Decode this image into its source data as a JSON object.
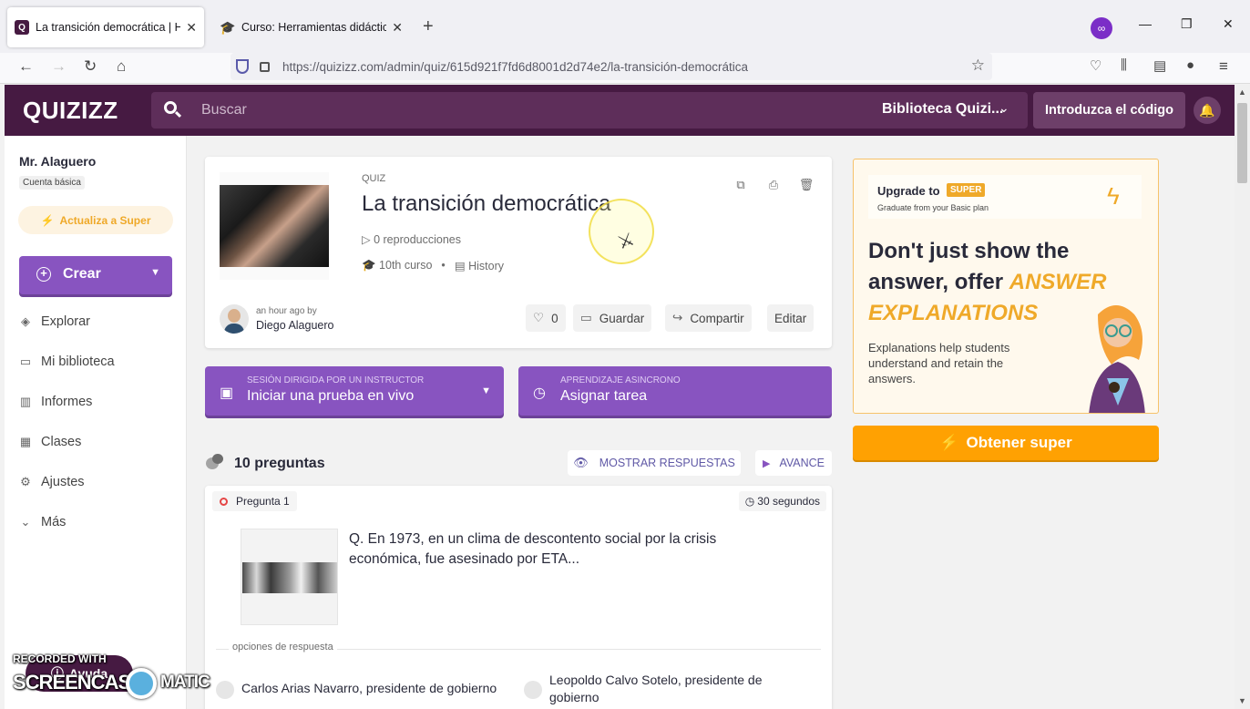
{
  "browser": {
    "tabs": [
      {
        "title": "La transición democrática | Hist",
        "active": true,
        "favicon": "quizizz-icon"
      },
      {
        "title": "Curso: Herramientas didácticas",
        "active": false,
        "favicon": "graduation-cap-icon"
      }
    ],
    "url": "https://quizizz.com/admin/quiz/615d921f7fd6d8001d2d74e2/la-transición-democrática"
  },
  "header": {
    "logo": "QUIZIZZ",
    "search_placeholder": "Buscar",
    "library_select": "Biblioteca Quizi...",
    "enter_code": "Introduzca el código"
  },
  "sidebar": {
    "user_name": "Mr. Alaguero",
    "account_type": "Cuenta básica",
    "upgrade_label": "Actualiza a Super",
    "create_label": "Crear",
    "items": [
      {
        "label": "Explorar",
        "icon": "compass-icon"
      },
      {
        "label": "Mi biblioteca",
        "icon": "folder-icon"
      },
      {
        "label": "Informes",
        "icon": "chart-icon"
      },
      {
        "label": "Clases",
        "icon": "classes-icon"
      },
      {
        "label": "Ajustes",
        "icon": "gear-icon"
      },
      {
        "label": "Más",
        "icon": "chevron-down-icon"
      }
    ]
  },
  "quiz": {
    "type_label": "QUIZ",
    "title": "La transición democrática",
    "plays": "0 reproducciones",
    "grade": "10th curso",
    "subject": "History",
    "updated": "an hour ago by",
    "author": "Diego Alaguero",
    "likes": "0",
    "save_label": "Guardar",
    "share_label": "Compartir",
    "edit_label": "Editar"
  },
  "host": {
    "live_sub": "SESIÓN DIRIGIDA POR UN INSTRUCTOR",
    "live_main": "Iniciar una prueba en vivo",
    "async_sub": "APRENDIZAJE ASINCRONO",
    "async_main": "Asignar tarea"
  },
  "questions": {
    "count_label": "10 preguntas",
    "show_answers": "MOSTRAR RESPUESTAS",
    "advance": "AVANCE",
    "items": [
      {
        "number": "Pregunta 1",
        "time": "30 segundos",
        "text": "Q. En 1973, en un clima de descontento social por la crisis económica, fue asesinado por ETA...",
        "options_label": "opciones de respuesta",
        "options": [
          "Carlos Arias Navarro, presidente de gobierno",
          "Leopoldo Calvo Sotelo, presidente de gobierno"
        ]
      }
    ]
  },
  "promo": {
    "upgrade_to": "Upgrade to",
    "super_badge": "SUPER",
    "graduate": "Graduate from your Basic plan",
    "headline_a": "Don't just show the answer, offer ",
    "headline_b": "ANSWER EXPLANATIONS",
    "description": "Explanations help students understand and retain the answers.",
    "cta": "Obtener super"
  },
  "help_label": "Ayuda",
  "watermark": {
    "line1": "RECORDED WITH",
    "line2": "SCREENCAST",
    "line3": "MATIC"
  },
  "colors": {
    "brand_dark": "#461a42",
    "primary_purple": "#8854c0",
    "super_orange": "#ffa102",
    "accent_yellow": "#efa929"
  }
}
